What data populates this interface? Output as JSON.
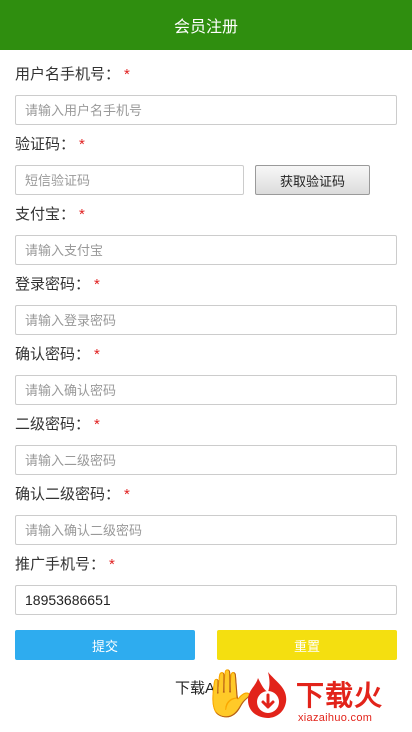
{
  "header": {
    "title": "会员注册"
  },
  "form": {
    "required_mark": "*",
    "username": {
      "label": "用户名手机号：",
      "placeholder": "请输入用户名手机号"
    },
    "verify": {
      "label": "验证码：",
      "placeholder": "短信验证码",
      "button": "获取验证码"
    },
    "alipay": {
      "label": "支付宝：",
      "placeholder": "请输入支付宝"
    },
    "login_password": {
      "label": "登录密码：",
      "placeholder": "请输入登录密码"
    },
    "confirm_password": {
      "label": "确认密码：",
      "placeholder": "请输入确认密码"
    },
    "second_password": {
      "label": "二级密码：",
      "placeholder": "请输入二级密码"
    },
    "confirm_second_password": {
      "label": "确认二级密码：",
      "placeholder": "请输入确认二级密码"
    },
    "referrer_phone": {
      "label": "推广手机号：",
      "value": "18953686651"
    }
  },
  "actions": {
    "submit": "提交",
    "reset": "重置"
  },
  "footer": {
    "download": "下载APP"
  },
  "watermark": {
    "brand": "下载火",
    "url": "xiazaihuo.com"
  },
  "colors": {
    "header": "#2f8e0f",
    "submit": "#2eacef",
    "reset": "#f4df10",
    "required": "#e02020",
    "watermark": "#e2231a"
  },
  "icons": [
    "fire-logo-icon"
  ]
}
